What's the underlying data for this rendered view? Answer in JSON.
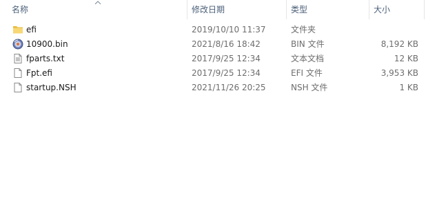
{
  "columns": {
    "name": "名称",
    "date": "修改日期",
    "type": "类型",
    "size": "大小"
  },
  "files": [
    {
      "name": "efi",
      "date": "2019/10/10 11:37",
      "type": "文件夹",
      "size": "",
      "icon": "folder-icon"
    },
    {
      "name": "10900.bin",
      "date": "2021/8/16 18:42",
      "type": "BIN 文件",
      "size": "8,192 KB",
      "icon": "bin-file-icon"
    },
    {
      "name": "fparts.txt",
      "date": "2017/9/25 12:34",
      "type": "文本文档",
      "size": "12 KB",
      "icon": "text-file-icon"
    },
    {
      "name": "Fpt.efi",
      "date": "2017/9/25 12:34",
      "type": "EFI 文件",
      "size": "3,953 KB",
      "icon": "efi-file-icon"
    },
    {
      "name": "startup.NSH",
      "date": "2021/11/26 20:25",
      "type": "NSH 文件",
      "size": "1 KB",
      "icon": "nsh-file-icon"
    }
  ],
  "colors": {
    "header_text": "#4c607a",
    "secondary_text": "#6d6d6d",
    "folder": "#f8d775"
  }
}
